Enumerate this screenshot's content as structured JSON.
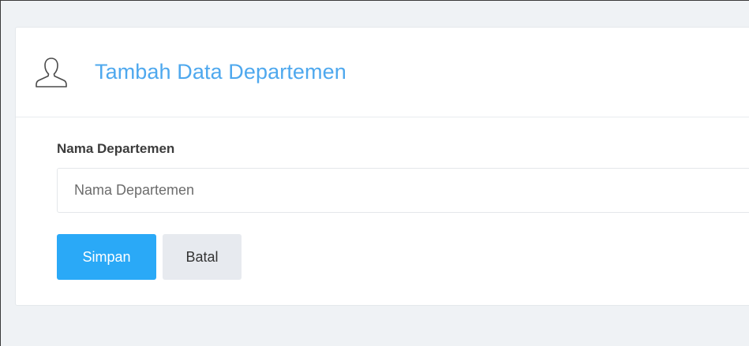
{
  "card": {
    "icon": "user-outline-icon",
    "title": "Tambah Data Departemen"
  },
  "form": {
    "name_label": "Nama Departemen",
    "name_placeholder": "Nama Departemen",
    "name_value": ""
  },
  "actions": {
    "save_label": "Simpan",
    "cancel_label": "Batal"
  },
  "colors": {
    "title": "#4ea8ee",
    "primary_button": "#2aa9f7",
    "secondary_button": "#e7eaef",
    "page_background": "#eff2f5"
  }
}
